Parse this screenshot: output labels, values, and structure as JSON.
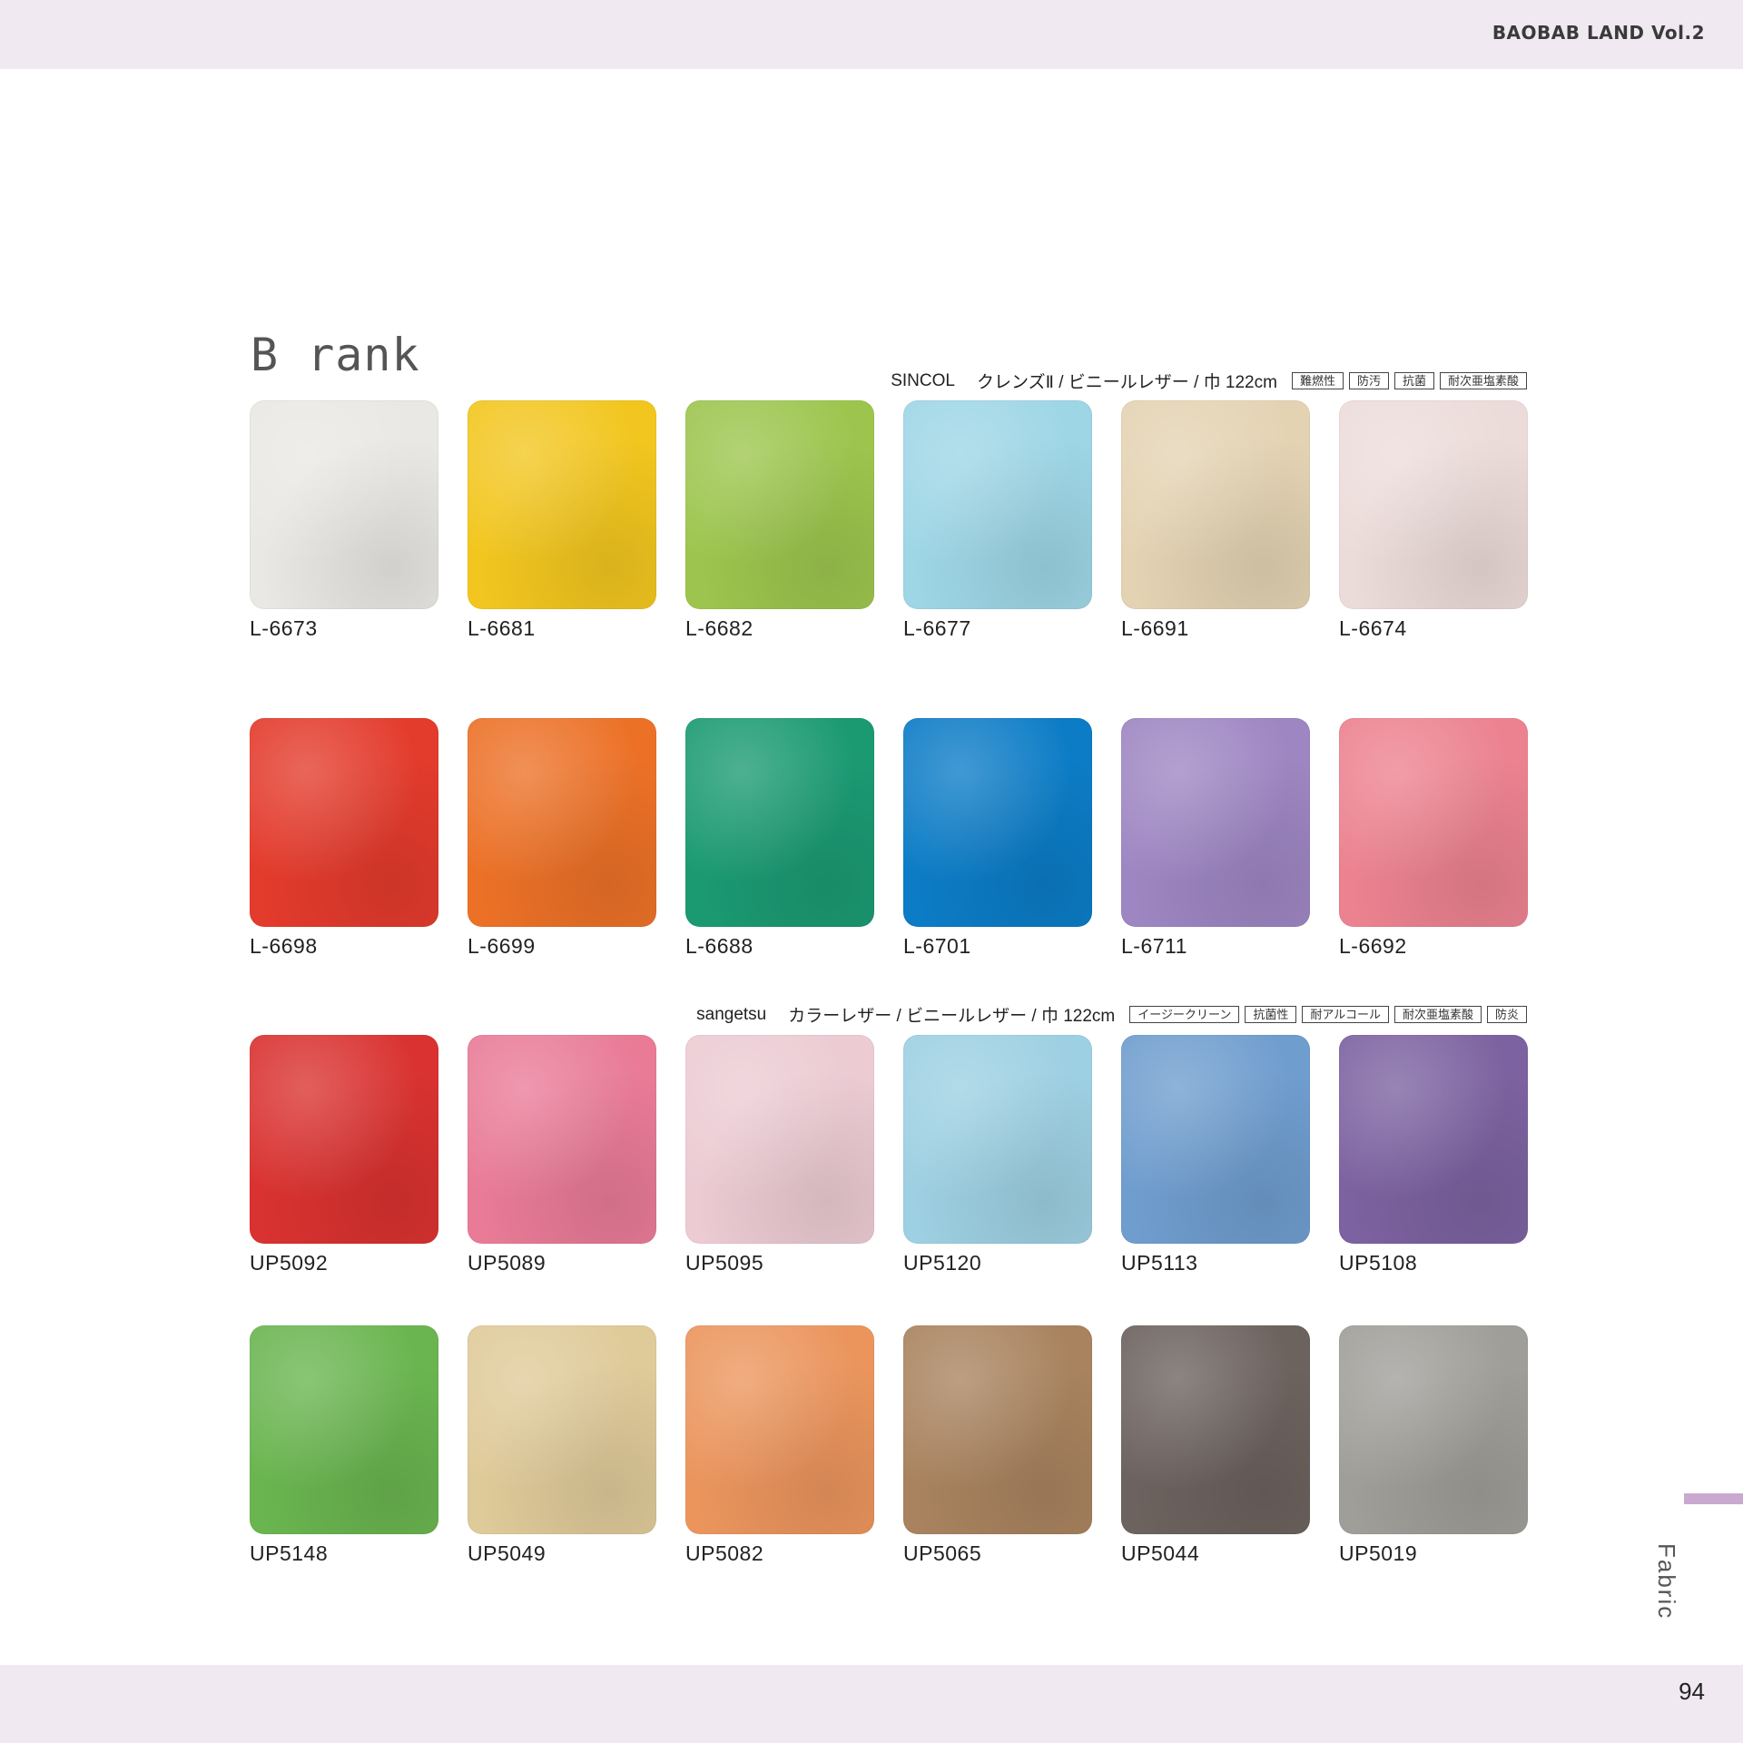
{
  "header": {
    "brand": "BAOBAB LAND Vol.2"
  },
  "footer": {
    "page_number": "94"
  },
  "side_tab": {
    "label": "Fabric",
    "color": "#c9a9cf"
  },
  "rank_title": "B rank",
  "sections": [
    {
      "brand": "SINCOL",
      "description": "クレンズⅡ / ビニールレザー / 巾 122cm",
      "badges": [
        "難燃性",
        "防汚",
        "抗菌",
        "耐次亜塩素酸"
      ],
      "rows": [
        [
          {
            "code": "L-6673",
            "color": "#e9e8e4"
          },
          {
            "code": "L-6681",
            "color": "#f2c61f"
          },
          {
            "code": "L-6682",
            "color": "#9dc54e"
          },
          {
            "code": "L-6677",
            "color": "#9ed6e6"
          },
          {
            "code": "L-6691",
            "color": "#e4d3b3"
          },
          {
            "code": "L-6674",
            "color": "#ecdcd9"
          }
        ],
        [
          {
            "code": "L-6698",
            "color": "#e33b2c"
          },
          {
            "code": "L-6699",
            "color": "#ec7127"
          },
          {
            "code": "L-6688",
            "color": "#1b9a72"
          },
          {
            "code": "L-6701",
            "color": "#0c7cc6"
          },
          {
            "code": "L-6711",
            "color": "#9e86c2"
          },
          {
            "code": "L-6692",
            "color": "#ec8290"
          }
        ]
      ]
    },
    {
      "brand": "sangetsu",
      "description": "カラーレザー / ビニールレザー / 巾 122cm",
      "badges": [
        "イージークリーン",
        "抗菌性",
        "耐アルコール",
        "耐次亜塩素酸",
        "防炎"
      ],
      "rows": [
        [
          {
            "code": "UP5092",
            "color": "#d93230"
          },
          {
            "code": "UP5089",
            "color": "#e97b97"
          },
          {
            "code": "UP5095",
            "color": "#eccbd3"
          },
          {
            "code": "UP5120",
            "color": "#9dd0e2"
          },
          {
            "code": "UP5113",
            "color": "#6f9dce"
          },
          {
            "code": "UP5108",
            "color": "#7c62a0"
          }
        ],
        [
          {
            "code": "UP5148",
            "color": "#6ab550"
          },
          {
            "code": "UP5049",
            "color": "#dfca99"
          },
          {
            "code": "UP5082",
            "color": "#eb955d"
          },
          {
            "code": "UP5065",
            "color": "#a9835f"
          },
          {
            "code": "UP5044",
            "color": "#6c625e"
          },
          {
            "code": "UP5019",
            "color": "#a09e99"
          }
        ]
      ]
    }
  ]
}
